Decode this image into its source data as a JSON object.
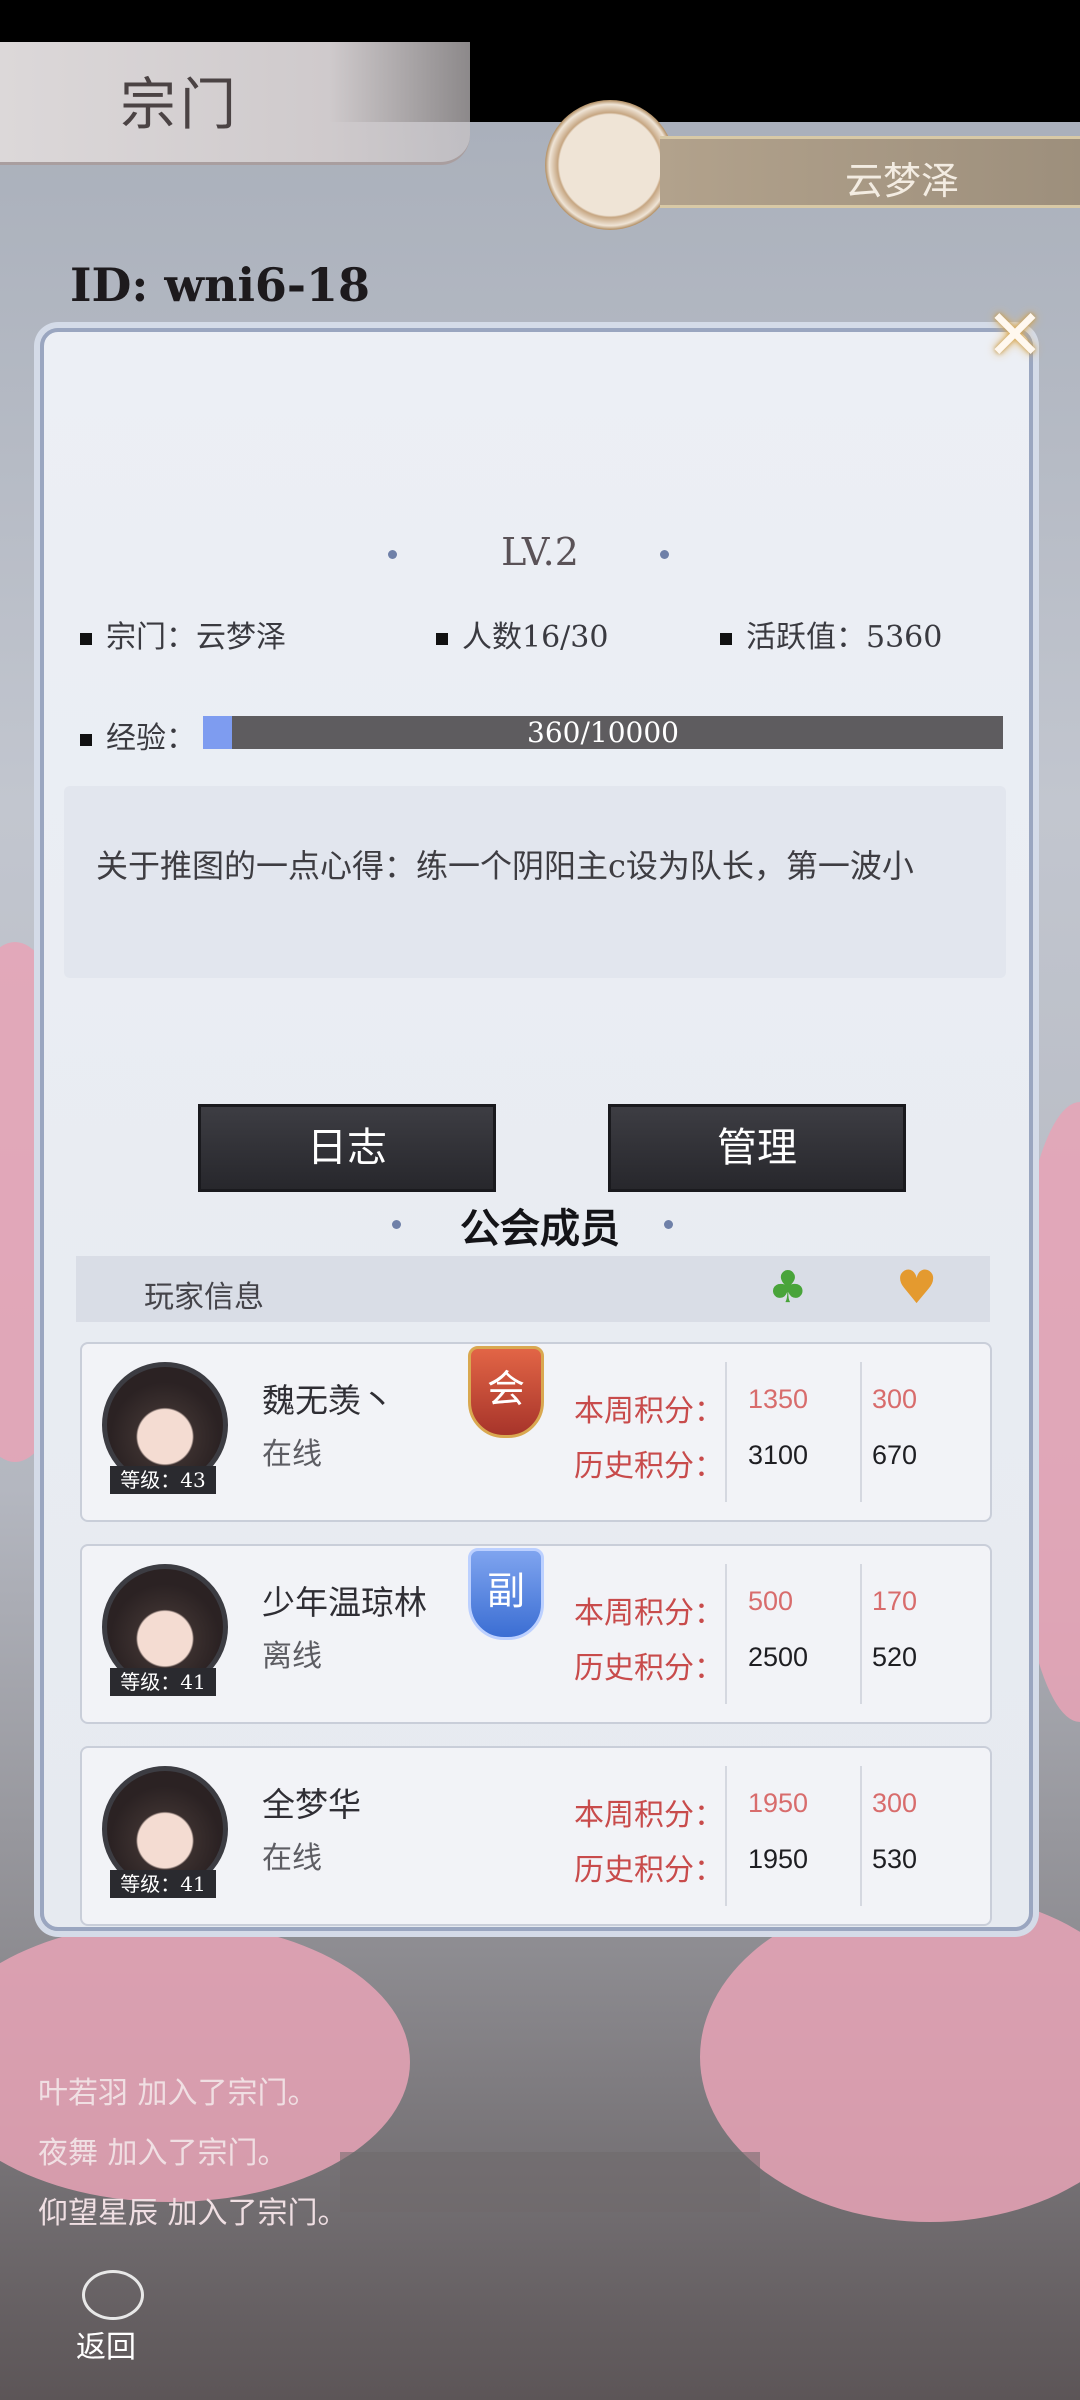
{
  "header": {
    "title": "宗门",
    "guild_name": "云梦泽",
    "id_label": "ID: wni6-18"
  },
  "panel": {
    "level": "LV.2",
    "info": {
      "sect": "宗门：云梦泽",
      "members": "人数16/30",
      "activity": "活跃值：5360"
    },
    "exp": {
      "label": "经验：",
      "text": "360/10000",
      "current": 360,
      "max": 10000
    },
    "notice": "关于推图的一点心得：练一个阴阳主c设为队长，第一波小",
    "buttons": {
      "log": "日志",
      "manage": "管理"
    },
    "members_title": "公会成员",
    "table_header": {
      "label": "玩家信息",
      "col1_icon": "gourd-icon",
      "col2_icon": "heart-icon"
    },
    "members": [
      {
        "name": "魏无羡丶",
        "status": "在线",
        "level": "等级：43",
        "badge": "会",
        "badge_color": "red",
        "week_label": "本周积分：",
        "hist_label": "历史积分：",
        "week1": "1350",
        "week2": "300",
        "hist1": "3100",
        "hist2": "670"
      },
      {
        "name": "少年温琼林",
        "status": "离线",
        "level": "等级：41",
        "badge": "副",
        "badge_color": "blue",
        "week_label": "本周积分：",
        "hist_label": "历史积分：",
        "week1": "500",
        "week2": "170",
        "hist1": "2500",
        "hist2": "520"
      },
      {
        "name": "全梦华",
        "status": "在线",
        "level": "等级：41",
        "badge": "",
        "badge_color": "",
        "week_label": "本周积分：",
        "hist_label": "历史积分：",
        "week1": "1950",
        "week2": "300",
        "hist1": "1950",
        "hist2": "530"
      }
    ]
  },
  "log_lines": [
    "叶若羽 加入了宗门。",
    "夜舞 加入了宗门。",
    "仰望星辰 加入了宗门。"
  ],
  "footer": {
    "back_label": "返回"
  },
  "colors": {
    "accent_blue": "#7e9cf0",
    "score_red": "#c84b4b",
    "button_dark": "#2f2f35"
  }
}
